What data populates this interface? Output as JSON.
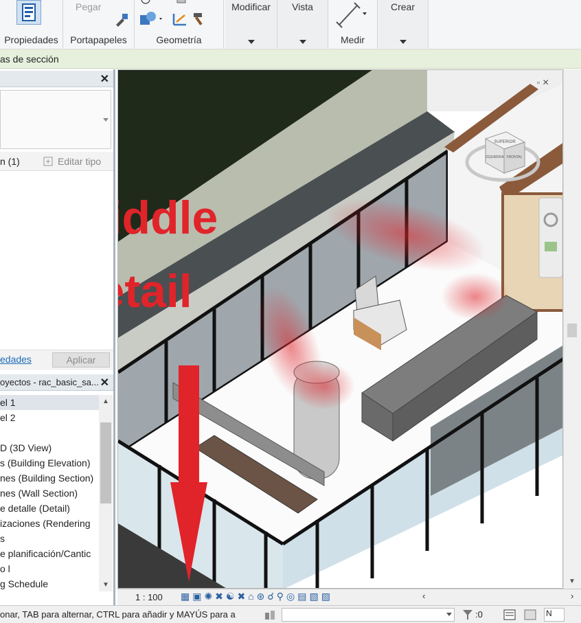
{
  "ribbon": {
    "propiedades_label": "Propiedades",
    "portapapeles_label": "Portapapeles",
    "pegar_label": "Pegar",
    "geometria_label": "Geometría",
    "modificar_label": "Modificar",
    "vista_label": "Vista",
    "medir_label": "Medir",
    "crear_label": "Crear"
  },
  "options_bar": {
    "text": "as de sección"
  },
  "properties_panel": {
    "type_selector_value": "n (1)",
    "edit_type_label": "Editar tipo",
    "link_text": "edades",
    "apply_label": "Aplicar"
  },
  "project_browser": {
    "title": "oyectos - rac_basic_sa...",
    "items": [
      "el 1",
      "el 2",
      "",
      "D (3D View)",
      "s (Building Elevation)",
      "nes (Building Section)",
      "nes (Wall Section)",
      "e detalle (Detail)",
      "izaciones (Rendering",
      "s",
      "e planificación/Cantic",
      "o l",
      "g Schedule"
    ]
  },
  "viewport": {
    "view_cube_top": "SUPERIOR",
    "view_cube_left": "IZQUIERDA",
    "view_cube_right": "FRONTAL",
    "annotation_text_line1": "Middle",
    "annotation_text_line2": "detail"
  },
  "view_control_bar": {
    "scale": "1 : 100"
  },
  "status_bar": {
    "text": "onar, TAB para alternar, CTRL para añadir y MAYÚS para a",
    "filter_count": ":0"
  },
  "colors": {
    "annotation_red": "#e0242a",
    "options_bar_bg": "#e7f0dc",
    "ribbon_bg": "#f5f6f7"
  }
}
